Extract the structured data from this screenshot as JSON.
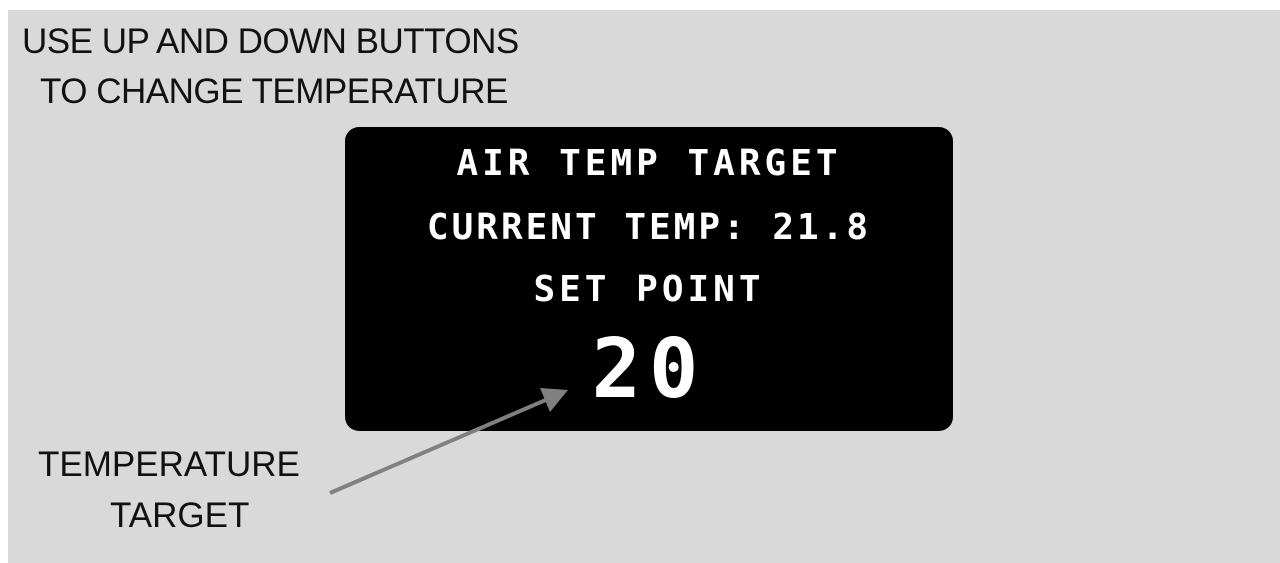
{
  "instructions": {
    "line1": "USE UP AND DOWN BUTTONS",
    "line2": "TO CHANGE TEMPERATURE"
  },
  "display": {
    "title": "AIR TEMP TARGET",
    "current_temp": "CURRENT TEMP: 21.8",
    "set_point_label": "SET POINT",
    "set_point_value": "20"
  },
  "callout": {
    "line1": "TEMPERATURE",
    "line2": "TARGET"
  },
  "colors": {
    "background": "#d9d9d9",
    "screen": "#000000",
    "screen_text": "#ffffff",
    "arrow": "#808080"
  }
}
